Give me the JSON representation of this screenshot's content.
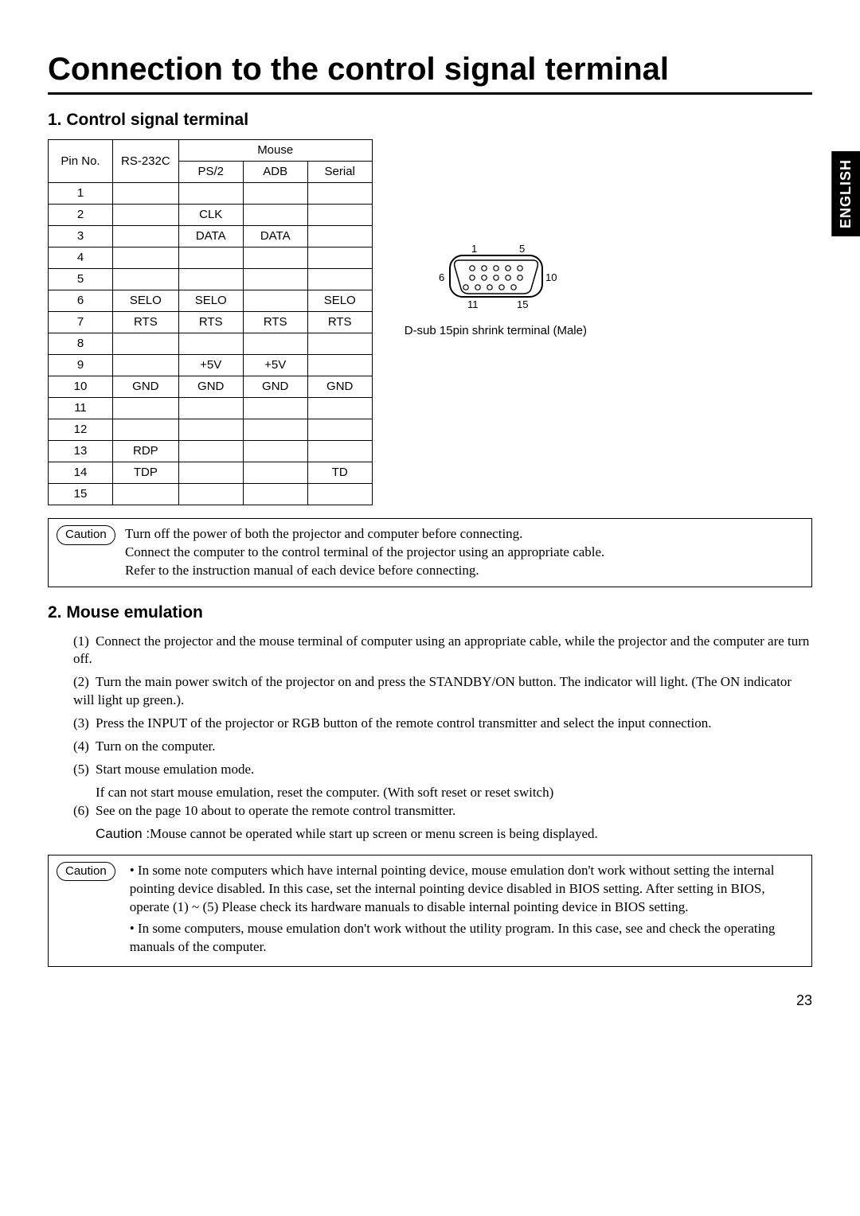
{
  "sidetab": "ENGLISH",
  "title": "Connection to the control signal terminal",
  "section1": "1. Control signal terminal",
  "table": {
    "headers": {
      "pin": "Pin No.",
      "rs232c": "RS-232C",
      "mouse": "Mouse",
      "ps2": "PS/2",
      "adb": "ADB",
      "serial": "Serial"
    },
    "rows": [
      {
        "pin": "1",
        "rs232c": "",
        "ps2": "",
        "adb": "",
        "serial": ""
      },
      {
        "pin": "2",
        "rs232c": "",
        "ps2": "CLK",
        "adb": "",
        "serial": ""
      },
      {
        "pin": "3",
        "rs232c": "",
        "ps2": "DATA",
        "adb": "DATA",
        "serial": ""
      },
      {
        "pin": "4",
        "rs232c": "",
        "ps2": "",
        "adb": "",
        "serial": ""
      },
      {
        "pin": "5",
        "rs232c": "",
        "ps2": "",
        "adb": "",
        "serial": ""
      },
      {
        "pin": "6",
        "rs232c": "SELO",
        "ps2": "SELO",
        "adb": "",
        "serial": "SELO"
      },
      {
        "pin": "7",
        "rs232c": "RTS",
        "ps2": "RTS",
        "adb": "RTS",
        "serial": "RTS"
      },
      {
        "pin": "8",
        "rs232c": "",
        "ps2": "",
        "adb": "",
        "serial": ""
      },
      {
        "pin": "9",
        "rs232c": "",
        "ps2": "+5V",
        "adb": "+5V",
        "serial": ""
      },
      {
        "pin": "10",
        "rs232c": "GND",
        "ps2": "GND",
        "adb": "GND",
        "serial": "GND"
      },
      {
        "pin": "11",
        "rs232c": "",
        "ps2": "",
        "adb": "",
        "serial": ""
      },
      {
        "pin": "12",
        "rs232c": "",
        "ps2": "",
        "adb": "",
        "serial": ""
      },
      {
        "pin": "13",
        "rs232c": "RDP",
        "ps2": "",
        "adb": "",
        "serial": ""
      },
      {
        "pin": "14",
        "rs232c": "TDP",
        "ps2": "",
        "adb": "",
        "serial": "TD"
      },
      {
        "pin": "15",
        "rs232c": "",
        "ps2": "",
        "adb": "",
        "serial": ""
      }
    ]
  },
  "connector": {
    "label_1": "1",
    "label_5": "5",
    "label_6": "6",
    "label_10": "10",
    "label_11": "11",
    "label_15": "15",
    "caption": "D-sub 15pin shrink terminal (Male)"
  },
  "caution1": {
    "badge": "Caution",
    "lines": [
      "Turn off the power of both the projector and computer before connecting.",
      "Connect the computer to the control terminal of the projector using an appropriate cable.",
      "Refer to the instruction manual of each device before connecting."
    ]
  },
  "section2": "2. Mouse emulation",
  "steps": [
    {
      "num": "(1)",
      "text": "Connect the projector and the mouse terminal of computer using an appropriate cable, while the projector and the computer are turn off."
    },
    {
      "num": "(2)",
      "text": "Turn the main power switch of the projector on and press the STANDBY/ON button. The indicator will light. (The ON indicator will light up green.)."
    },
    {
      "num": "(3)",
      "text": "Press the INPUT of the projector or RGB button of the remote control transmitter and select the input connection."
    },
    {
      "num": "(4)",
      "text": "Turn on the computer."
    },
    {
      "num": "(5)",
      "text": "Start mouse emulation mode.",
      "sub": "If can not start mouse emulation, reset the computer. (With soft reset or reset switch)"
    },
    {
      "num": "(6)",
      "text": "See on the page 10 about to operate the remote control transmitter.",
      "caution_label": "Caution :",
      "caution_text": "Mouse cannot be operated while start up screen or menu screen is being displayed."
    }
  ],
  "caution2": {
    "badge": "Caution",
    "bullets": [
      "In some note computers which have internal pointing device, mouse emulation don't work without setting the internal pointing device disabled. In this case, set the internal pointing device disabled in BIOS setting. After setting in BIOS, operate (1) ~ (5) Please check its hardware manuals to disable internal pointing device in BIOS setting.",
      "In some computers, mouse emulation don't work without the utility program. In this case, see and check the operating manuals of the computer."
    ]
  },
  "page_number": "23"
}
